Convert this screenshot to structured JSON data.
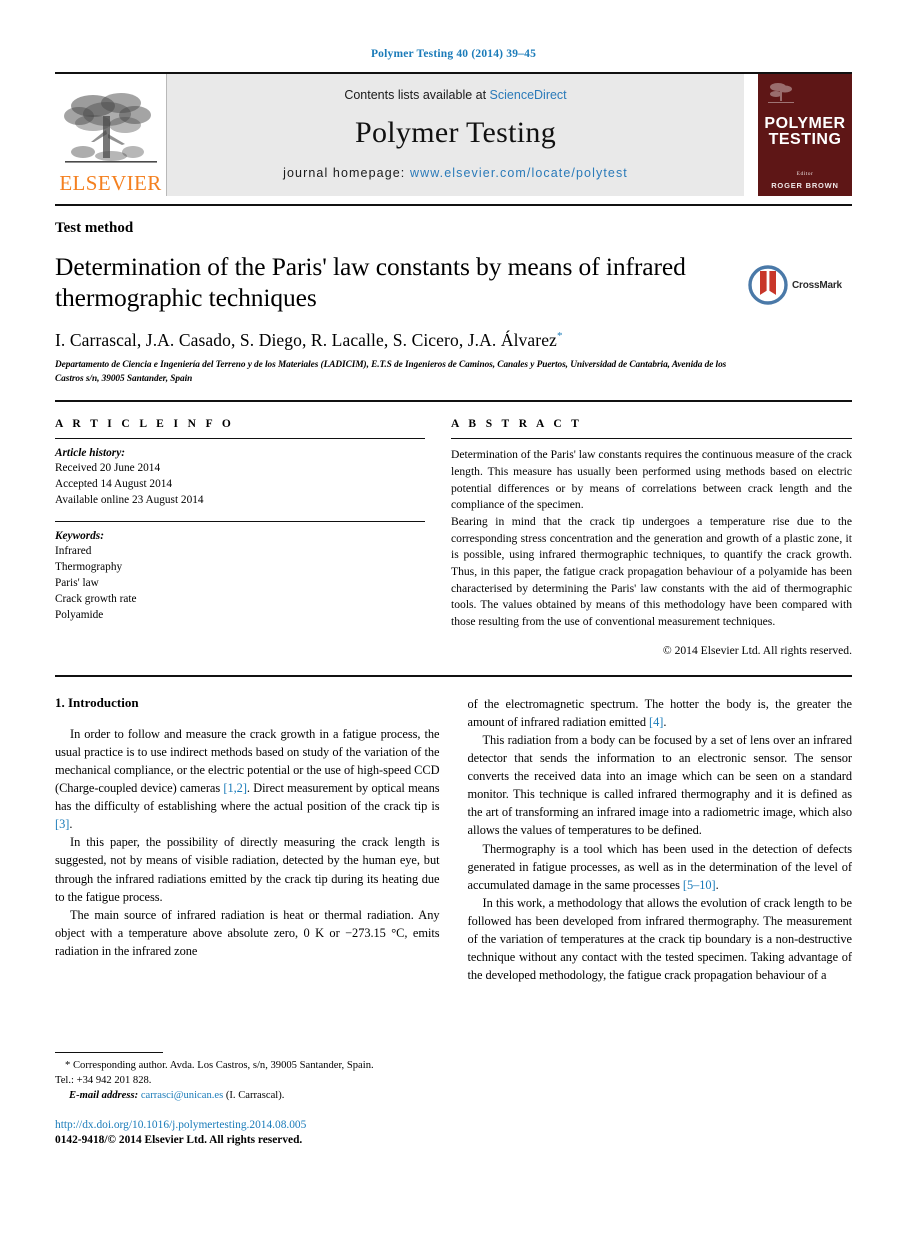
{
  "running_head": "Polymer Testing 40 (2014) 39–45",
  "masthead": {
    "publisher_name": "ELSEVIER",
    "contents_line_prefix": "Contents lists available at ",
    "contents_line_link": "ScienceDirect",
    "journal_title": "Polymer Testing",
    "homepage_prefix": "journal homepage: ",
    "homepage_url": "www.elsevier.com/locate/polytest",
    "cover": {
      "title_line1": "POLYMER",
      "title_line2": "TESTING",
      "editor_label": "Editor",
      "editor_name": "ROGER BROWN"
    }
  },
  "article": {
    "type_label": "Test method",
    "title": "Determination of the Paris' law constants by means of infrared thermographic techniques",
    "authors": "I. Carrascal, J.A. Casado, S. Diego, R. Lacalle, S. Cicero, J.A. Álvarez",
    "author_marker": "*",
    "affiliation": "Departamento de Ciencia e Ingeniería del Terreno y de los Materiales (LADICIM), E.T.S de Ingenieros de Caminos, Canales y Puertos, Universidad de Cantabria, Avenida de los Castros s/n, 39005 Santander, Spain",
    "crossmark_label": "CrossMark"
  },
  "article_info": {
    "heading": "A R T I C L E   I N F O",
    "history_label": "Article history:",
    "history": [
      "Received 20 June 2014",
      "Accepted 14 August 2014",
      "Available online 23 August 2014"
    ],
    "keywords_label": "Keywords:",
    "keywords": [
      "Infrared",
      "Thermography",
      "Paris' law",
      "Crack growth rate",
      "Polyamide"
    ]
  },
  "abstract": {
    "heading": "A B S T R A C T",
    "paragraphs": [
      "Determination of the Paris' law constants requires the continuous measure of the crack length. This measure has usually been performed using methods based on electric potential differences or by means of correlations between crack length and the compliance of the specimen.",
      "Bearing in mind that the crack tip undergoes a temperature rise due to the corresponding stress concentration and the generation and growth of a plastic zone, it is possible, using infrared thermographic techniques, to quantify the crack growth. Thus, in this paper, the fatigue crack propagation behaviour of a polyamide has been characterised by determining the Paris' law constants with the aid of thermographic tools. The values obtained by means of this methodology have been compared with those resulting from the use of conventional measurement techniques."
    ],
    "copyright": "© 2014 Elsevier Ltd. All rights reserved."
  },
  "body": {
    "section_heading": "1. Introduction",
    "left_paragraphs": [
      "In order to follow and measure the crack growth in a fatigue process, the usual practice is to use indirect methods based on study of the variation of the mechanical compliance, or the electric potential or the use of high-speed CCD (Charge-coupled device) cameras [1,2]. Direct measurement by optical means has the difficulty of establishing where the actual position of the crack tip is [3].",
      "In this paper, the possibility of directly measuring the crack length is suggested, not by means of visible radiation, detected by the human eye, but through the infrared radiations emitted by the crack tip during its heating due to the fatigue process.",
      "The main source of infrared radiation is heat or thermal radiation. Any object with a temperature above absolute zero, 0 K or −273.15 °C, emits radiation in the infrared zone"
    ],
    "right_paragraphs": [
      "of the electromagnetic spectrum. The hotter the body is, the greater the amount of infrared radiation emitted [4].",
      "This radiation from a body can be focused by a set of lens over an infrared detector that sends the information to an electronic sensor. The sensor converts the received data into an image which can be seen on a standard monitor. This technique is called infrared thermography and it is defined as the art of transforming an infrared image into a radiometric image, which also allows the values of temperatures to be defined.",
      "Thermography is a tool which has been used in the detection of defects generated in fatigue processes, as well as in the determination of the level of accumulated damage in the same processes [5–10].",
      "In this work, a methodology that allows the evolution of crack length to be followed has been developed from infrared thermography. The measurement of the variation of temperatures at the crack tip boundary is a non-destructive technique without any contact with the tested specimen. Taking advantage of the developed methodology, the fatigue crack propagation behaviour of a"
    ]
  },
  "footnote": {
    "marker": "*",
    "line1": "Corresponding author. Avda. Los Castros, s/n, 39005 Santander, Spain.",
    "line2": "Tel.: +34 942 201 828.",
    "email_label": "E-mail address:",
    "email": "carrasci@unican.es",
    "email_owner": "(I. Carrascal)."
  },
  "footer": {
    "doi": "http://dx.doi.org/10.1016/j.polymertesting.2014.08.005",
    "issn_copyright": "0142-9418/© 2014 Elsevier Ltd. All rights reserved."
  },
  "colors": {
    "link_blue": "#1a7bb9",
    "elsevier_orange": "#f48020",
    "cover_maroon": "#5e1616",
    "banner_gray": "#e9e9e9"
  }
}
